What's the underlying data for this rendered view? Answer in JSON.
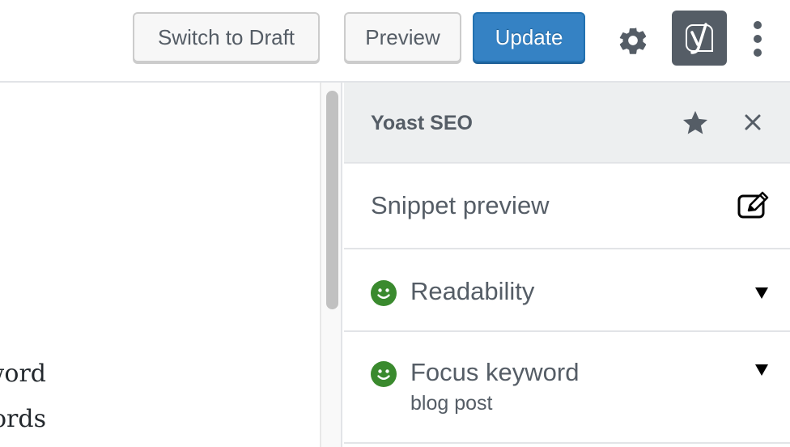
{
  "toolbar": {
    "switch_to_draft_label": "Switch to Draft",
    "preview_label": "Preview",
    "update_label": "Update",
    "settings_icon": "gear-icon",
    "yoast_icon": "yoast-logo-icon",
    "more_icon": "vertical-ellipsis-icon"
  },
  "editor": {
    "visible_lines": [
      "word",
      "ords"
    ]
  },
  "sidebar": {
    "title": "Yoast SEO",
    "star_icon": "star-icon",
    "close_icon": "close-icon",
    "panels": [
      {
        "label": "Snippet preview",
        "icon": "edit-icon"
      },
      {
        "label": "Readability",
        "status": "good",
        "icon": "smiley-icon",
        "expand_icon": "caret-down-icon"
      },
      {
        "label": "Focus keyword",
        "sublabel": "blog post",
        "status": "good",
        "icon": "smiley-icon",
        "expand_icon": "caret-down-icon"
      }
    ]
  },
  "colors": {
    "primary_button": "#3582c4",
    "good_status": "#3a8a2e",
    "icon_gray": "#555d66"
  }
}
